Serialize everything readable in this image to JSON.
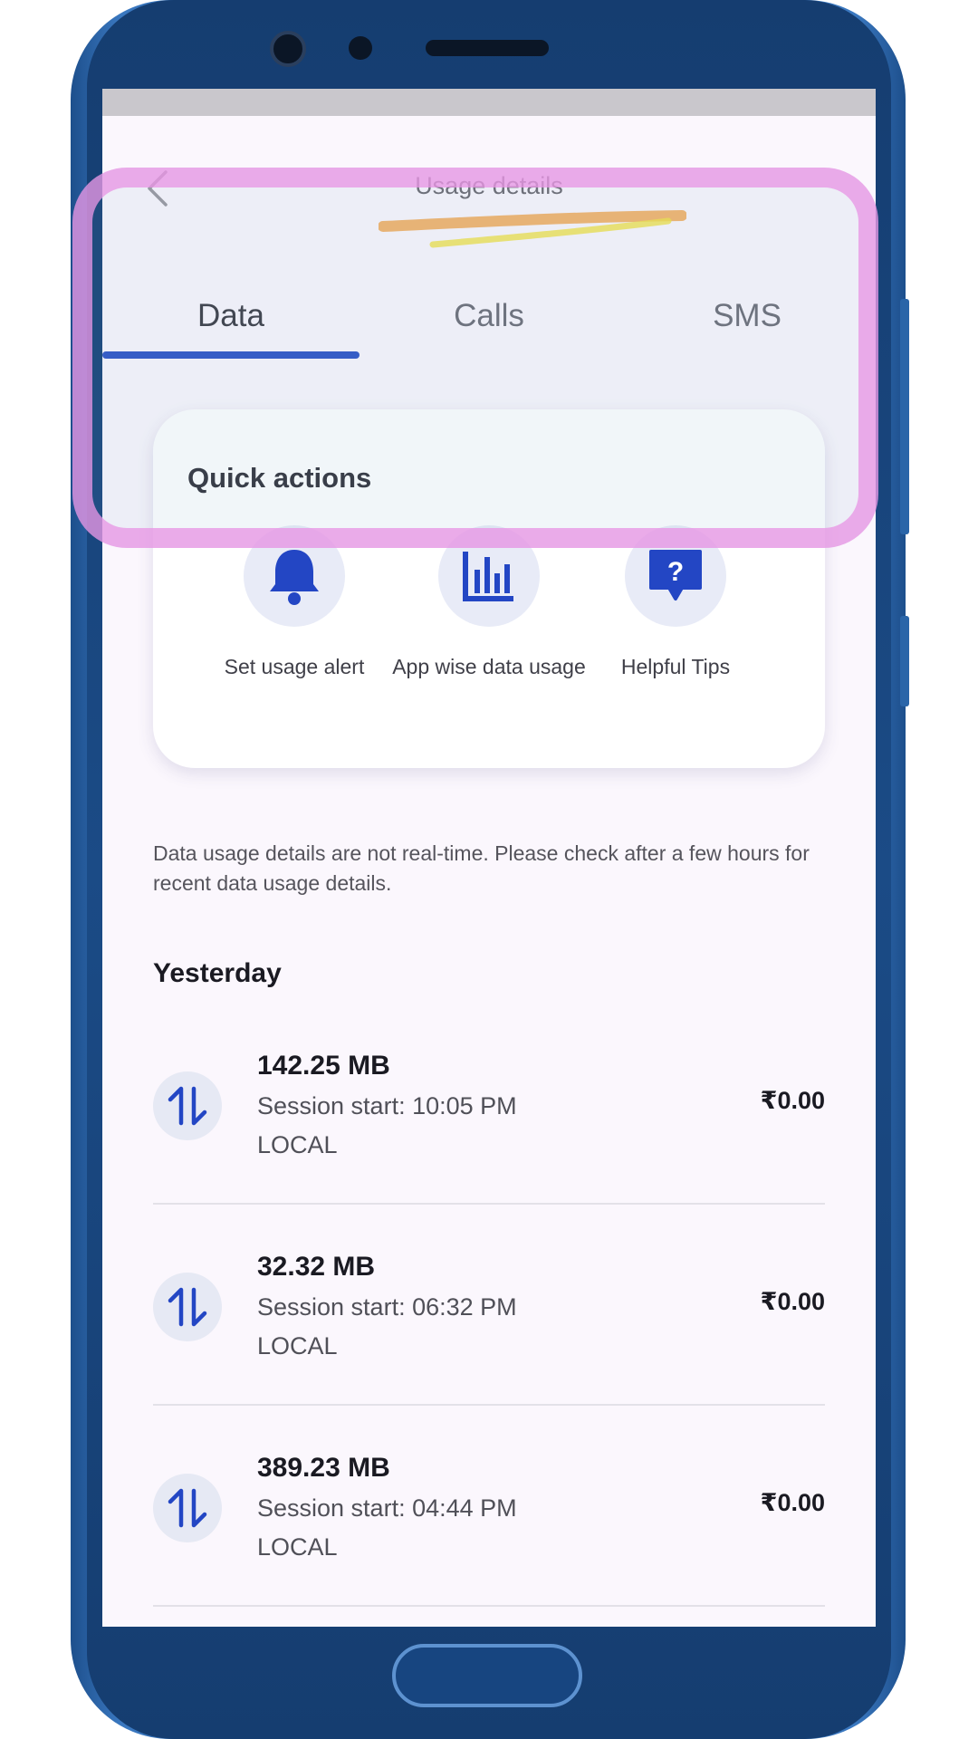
{
  "header": {
    "title": "Usage details",
    "accent_color": "#2f55c7"
  },
  "tabs": [
    {
      "label": "Data",
      "active": true
    },
    {
      "label": "Calls",
      "active": false
    },
    {
      "label": "SMS",
      "active": false
    }
  ],
  "quick_actions": {
    "title": "Quick actions",
    "items": [
      {
        "label": "Set usage alert",
        "icon": "bell-icon"
      },
      {
        "label": "App wise data usage",
        "icon": "bar-chart-icon"
      },
      {
        "label": "Helpful Tips",
        "icon": "help-bubble-icon"
      }
    ]
  },
  "notice": "Data usage details are not real-time. Please check after a few hours for recent data usage details.",
  "section": {
    "title": "Yesterday",
    "sessions": [
      {
        "size": "142.25 MB",
        "session": "Session start: 10:05 PM",
        "type": "LOCAL",
        "amount": "₹0.00"
      },
      {
        "size": "32.32 MB",
        "session": "Session start: 06:32 PM",
        "type": "LOCAL",
        "amount": "₹0.00"
      },
      {
        "size": "389.23 MB",
        "session": "Session start: 04:44 PM",
        "type": "LOCAL",
        "amount": "₹0.00"
      }
    ]
  },
  "annotation_color": "#e896e4"
}
